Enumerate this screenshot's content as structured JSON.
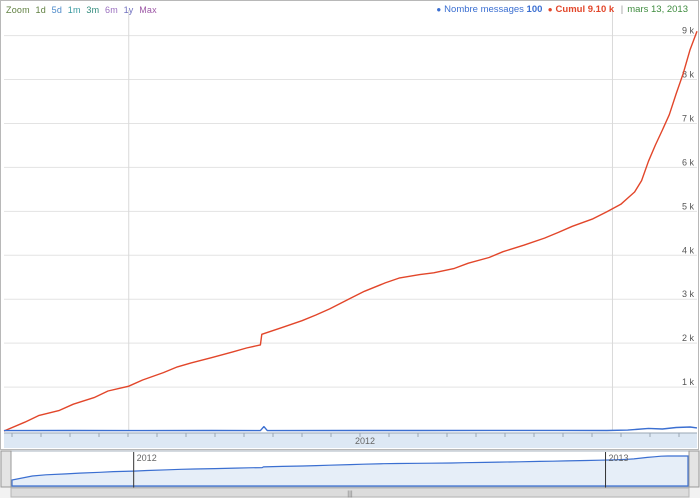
{
  "zoom": {
    "label": "Zoom",
    "options": [
      "1d",
      "5d",
      "1m",
      "3m",
      "6m",
      "1y",
      "Max"
    ],
    "colors": [
      "#5f7f3f",
      "#4a88c9",
      "#3a9aa0",
      "#2f8a7a",
      "#9a6fbf",
      "#6f6fbf",
      "#9d57a6"
    ]
  },
  "legend": {
    "series1_name": "Nombre messages",
    "series1_value": "100",
    "series1_color": "#3b6fd1",
    "series2_name": "Cumul",
    "series2_value": "9.10 k",
    "series2_color": "#e2462a",
    "date": "mars 13, 2013",
    "date_color": "#3f8c3f"
  },
  "chart_data": {
    "type": "line",
    "y_tick_labels": [
      "1 k",
      "2 k",
      "3 k",
      "4 k",
      "5 k",
      "6 k",
      "7 k",
      "8 k",
      "9 k"
    ],
    "ylim": [
      0,
      9400
    ],
    "x_axis_label": "2012",
    "grid": true,
    "legend_position": "top-right",
    "series": [
      {
        "name": "Cumul",
        "color": "#e2462a",
        "x": [
          0,
          0.03,
          0.05,
          0.08,
          0.1,
          0.13,
          0.15,
          0.18,
          0.2,
          0.23,
          0.25,
          0.27,
          0.3,
          0.33,
          0.35,
          0.37,
          0.372,
          0.4,
          0.43,
          0.45,
          0.47,
          0.5,
          0.52,
          0.55,
          0.57,
          0.6,
          0.62,
          0.65,
          0.67,
          0.7,
          0.72,
          0.75,
          0.78,
          0.8,
          0.82,
          0.85,
          0.87,
          0.89,
          0.9,
          0.91,
          0.92,
          0.93,
          0.94,
          0.95,
          0.96,
          0.97,
          0.98,
          0.99,
          1.0
        ],
        "values": [
          0,
          200,
          350,
          470,
          610,
          760,
          910,
          1020,
          1160,
          1330,
          1460,
          1550,
          1670,
          1800,
          1890,
          1960,
          2200,
          2350,
          2510,
          2640,
          2780,
          3020,
          3180,
          3370,
          3480,
          3560,
          3600,
          3700,
          3820,
          3950,
          4080,
          4230,
          4390,
          4520,
          4660,
          4830,
          4990,
          5160,
          5300,
          5440,
          5700,
          6140,
          6510,
          6850,
          7200,
          7680,
          8130,
          8680,
          9100
        ]
      },
      {
        "name": "Nombre messages",
        "color": "#3b6fd1",
        "x": [
          0,
          0.1,
          0.2,
          0.3,
          0.37,
          0.375,
          0.38,
          0.5,
          0.6,
          0.7,
          0.8,
          0.87,
          0.9,
          0.93,
          0.95,
          0.97,
          0.99,
          1.0
        ],
        "values": [
          10,
          12,
          9,
          11,
          10,
          100,
          10,
          12,
          11,
          13,
          14,
          12,
          20,
          60,
          45,
          80,
          90,
          70
        ]
      }
    ]
  },
  "navigator": {
    "year_labels": [
      "2012",
      "2013"
    ],
    "center_label": "|||"
  }
}
